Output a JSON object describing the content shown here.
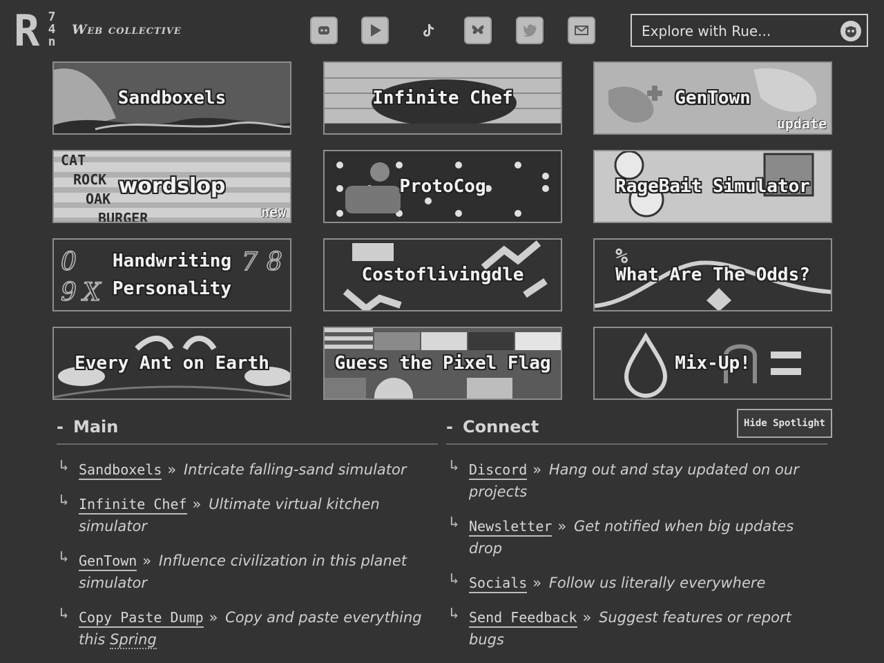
{
  "header": {
    "logo_main": "R",
    "logo_small": [
      "7",
      "4",
      "n"
    ],
    "brand": "Web collective",
    "search_placeholder": "Explore with Rue...",
    "socials": [
      "discord-icon",
      "youtube-icon",
      "tiktok-icon",
      "bluesky-icon",
      "twitter-icon",
      "mail-icon"
    ]
  },
  "tiles": [
    {
      "title": "Sandboxels",
      "badge": ""
    },
    {
      "title": "Infinite Chef",
      "badge": ""
    },
    {
      "title": "GenTown",
      "badge": "update"
    },
    {
      "title": "wordslop",
      "badge": "new",
      "words": [
        "CAT",
        "ROCK",
        "OAK",
        "BURGER"
      ]
    },
    {
      "title": "ProtoCog",
      "badge": ""
    },
    {
      "title": "RageBait Simulator",
      "badge": ""
    },
    {
      "title": "Handwriting\nPersonality",
      "badge": "",
      "digits": [
        "0",
        "7",
        "8",
        "9",
        "X"
      ]
    },
    {
      "title": "Costoflivingdle",
      "badge": ""
    },
    {
      "title": "What Are The Odds?",
      "badge": ""
    },
    {
      "title": "Every Ant on Earth",
      "badge": ""
    },
    {
      "title": "Guess the Pixel Flag",
      "badge": ""
    },
    {
      "title": "Mix-Up!",
      "badge": ""
    }
  ],
  "sections": {
    "main_title": "Main",
    "connect_title": "Connect",
    "hide_button": "Hide Spotlight",
    "main": [
      {
        "link": "Sandboxels",
        "desc": "Intricate falling-sand simulator"
      },
      {
        "link": "Infinite Chef",
        "desc": "Ultimate virtual kitchen simulator"
      },
      {
        "link": "GenTown",
        "desc": "Influence civilization in this planet simulator"
      },
      {
        "link": "Copy Paste Dump",
        "desc": "Copy and paste everything this",
        "desc_link": "Spring"
      }
    ],
    "connect": [
      {
        "link": "Discord",
        "desc": "Hang out and stay updated on our projects"
      },
      {
        "link": "Newsletter",
        "desc": "Get notified when big updates drop"
      },
      {
        "link": "Socials",
        "desc": "Follow us literally everywhere"
      },
      {
        "link": "Send Feedback",
        "desc": "Suggest features or report bugs"
      }
    ],
    "arrow": "↳",
    "separator": "»",
    "dash": "-"
  }
}
